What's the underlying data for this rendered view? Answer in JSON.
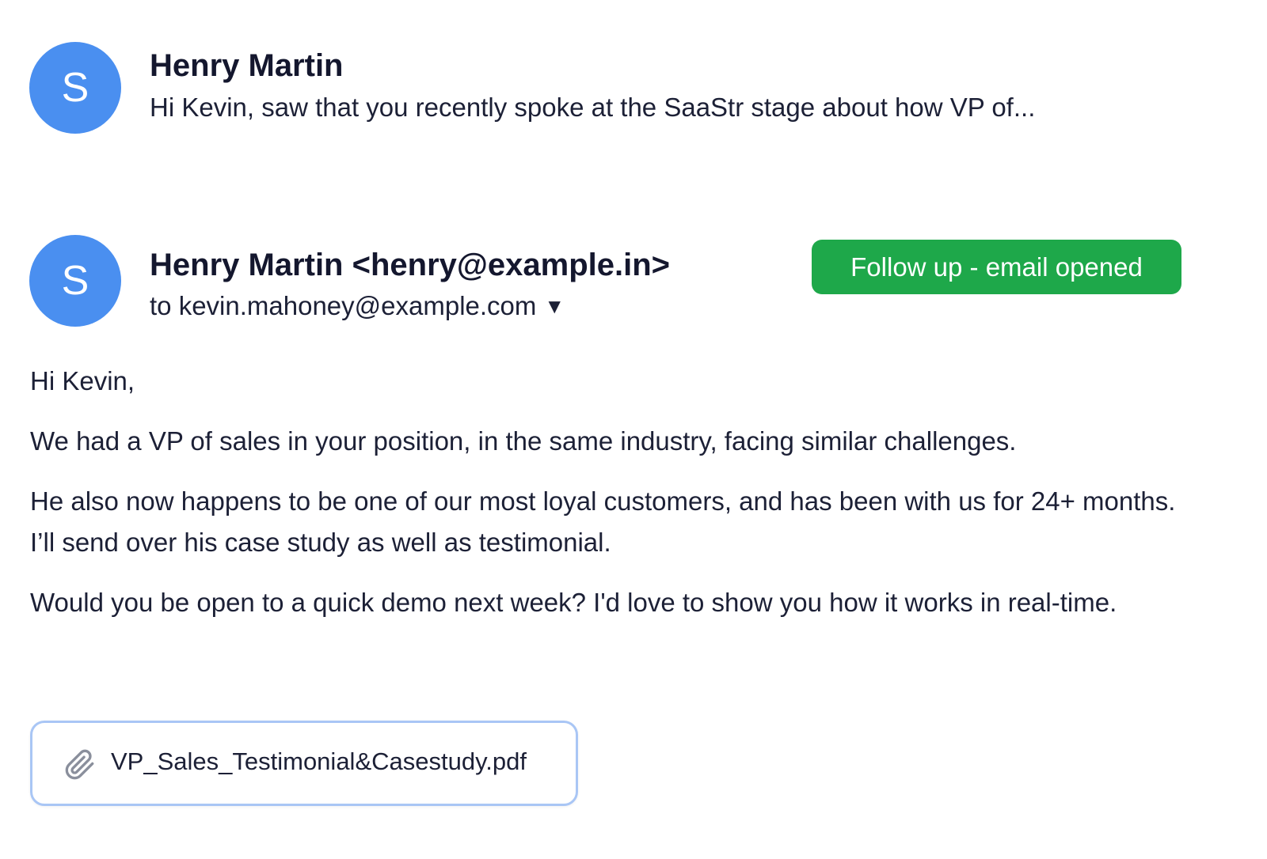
{
  "colors": {
    "avatar_bg": "#4a8ff0",
    "badge_bg": "#1ea84a",
    "attachment_border": "#a9c6f5",
    "text_primary": "#14172e"
  },
  "preview": {
    "avatar_initial": "S",
    "sender": "Henry Martin",
    "snippet": "Hi Kevin, saw that you recently spoke at the SaaStr stage about how VP of..."
  },
  "email": {
    "avatar_initial": "S",
    "from": "Henry Martin <henry@example.in>",
    "to": "to kevin.mahoney@example.com",
    "recipients_caret": "▼",
    "badge": "Follow up - email opened",
    "body": [
      "Hi Kevin,",
      "We had a VP of sales in your position, in the same industry, facing similar challenges.",
      "He also now happens to be one of our most loyal customers, and has been with us for 24+ months. I’ll send over his case study as well as testimonial.",
      "Would you be open to a quick demo next week? I'd love to show you how it works in real-time."
    ],
    "attachment": {
      "icon": "paperclip-icon",
      "filename": "VP_Sales_Testimonial&Casestudy.pdf"
    }
  }
}
